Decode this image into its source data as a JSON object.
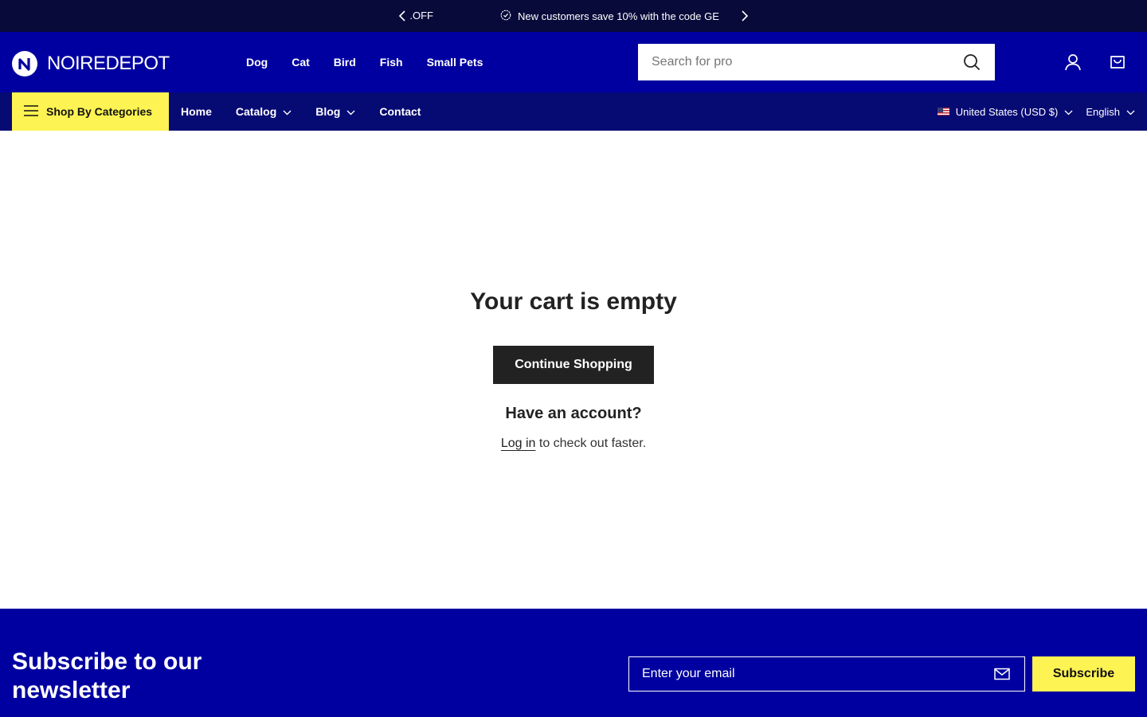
{
  "announcement": {
    "prev_fragment": "OFF.",
    "message": "New customers save 10% with the code GE"
  },
  "header": {
    "logo_text": "NOIREDEPOT",
    "categories": [
      "Dog",
      "Cat",
      "Bird",
      "Fish",
      "Small Pets"
    ],
    "search_placeholder": "Search for pro",
    "icons": [
      "search-icon",
      "account-icon",
      "cart-icon"
    ]
  },
  "nav": {
    "shop_by": "Shop By Categories",
    "links": [
      {
        "label": "Home",
        "dropdown": false
      },
      {
        "label": "Catalog",
        "dropdown": true
      },
      {
        "label": "Blog",
        "dropdown": true
      },
      {
        "label": "Contact",
        "dropdown": false
      }
    ],
    "country": "United States (USD $)",
    "language": "English"
  },
  "cart": {
    "title": "Your cart is empty",
    "continue": "Continue Shopping",
    "account_heading": "Have an account?",
    "login_link": "Log in",
    "login_rest": " to check out faster."
  },
  "newsletter": {
    "heading": "Subscribe to our newsletter",
    "email_placeholder": "Enter your email",
    "subscribe": "Subscribe"
  },
  "colors": {
    "announcement_bg": "#080b3a",
    "header_bg": "#0000a0",
    "nav_bg": "#060a73",
    "accent_yellow": "#fdf352",
    "button_dark": "#222222"
  }
}
